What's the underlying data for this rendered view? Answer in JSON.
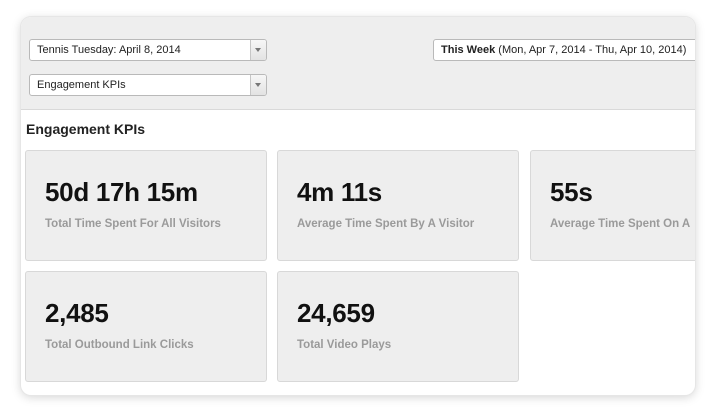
{
  "filters": {
    "event_select": "Tennis Tuesday: April 8, 2014",
    "kpi_select": "Engagement KPIs",
    "date_range_strong": "This Week",
    "date_range_detail": " (Mon, Apr 7, 2014 - Thu, Apr 10, 2014)"
  },
  "section": {
    "title": "Engagement KPIs"
  },
  "kpis": [
    {
      "value": "50d 17h 15m",
      "label": "Total Time Spent For All Visitors"
    },
    {
      "value": "4m 11s",
      "label": "Average Time Spent By A Visitor"
    },
    {
      "value": "55s",
      "label": "Average Time Spent On A"
    },
    {
      "value": "2,485",
      "label": "Total Outbound Link Clicks"
    },
    {
      "value": "24,659",
      "label": "Total Video Plays"
    }
  ],
  "icons": {
    "dropdown": "chevron-down-icon"
  }
}
